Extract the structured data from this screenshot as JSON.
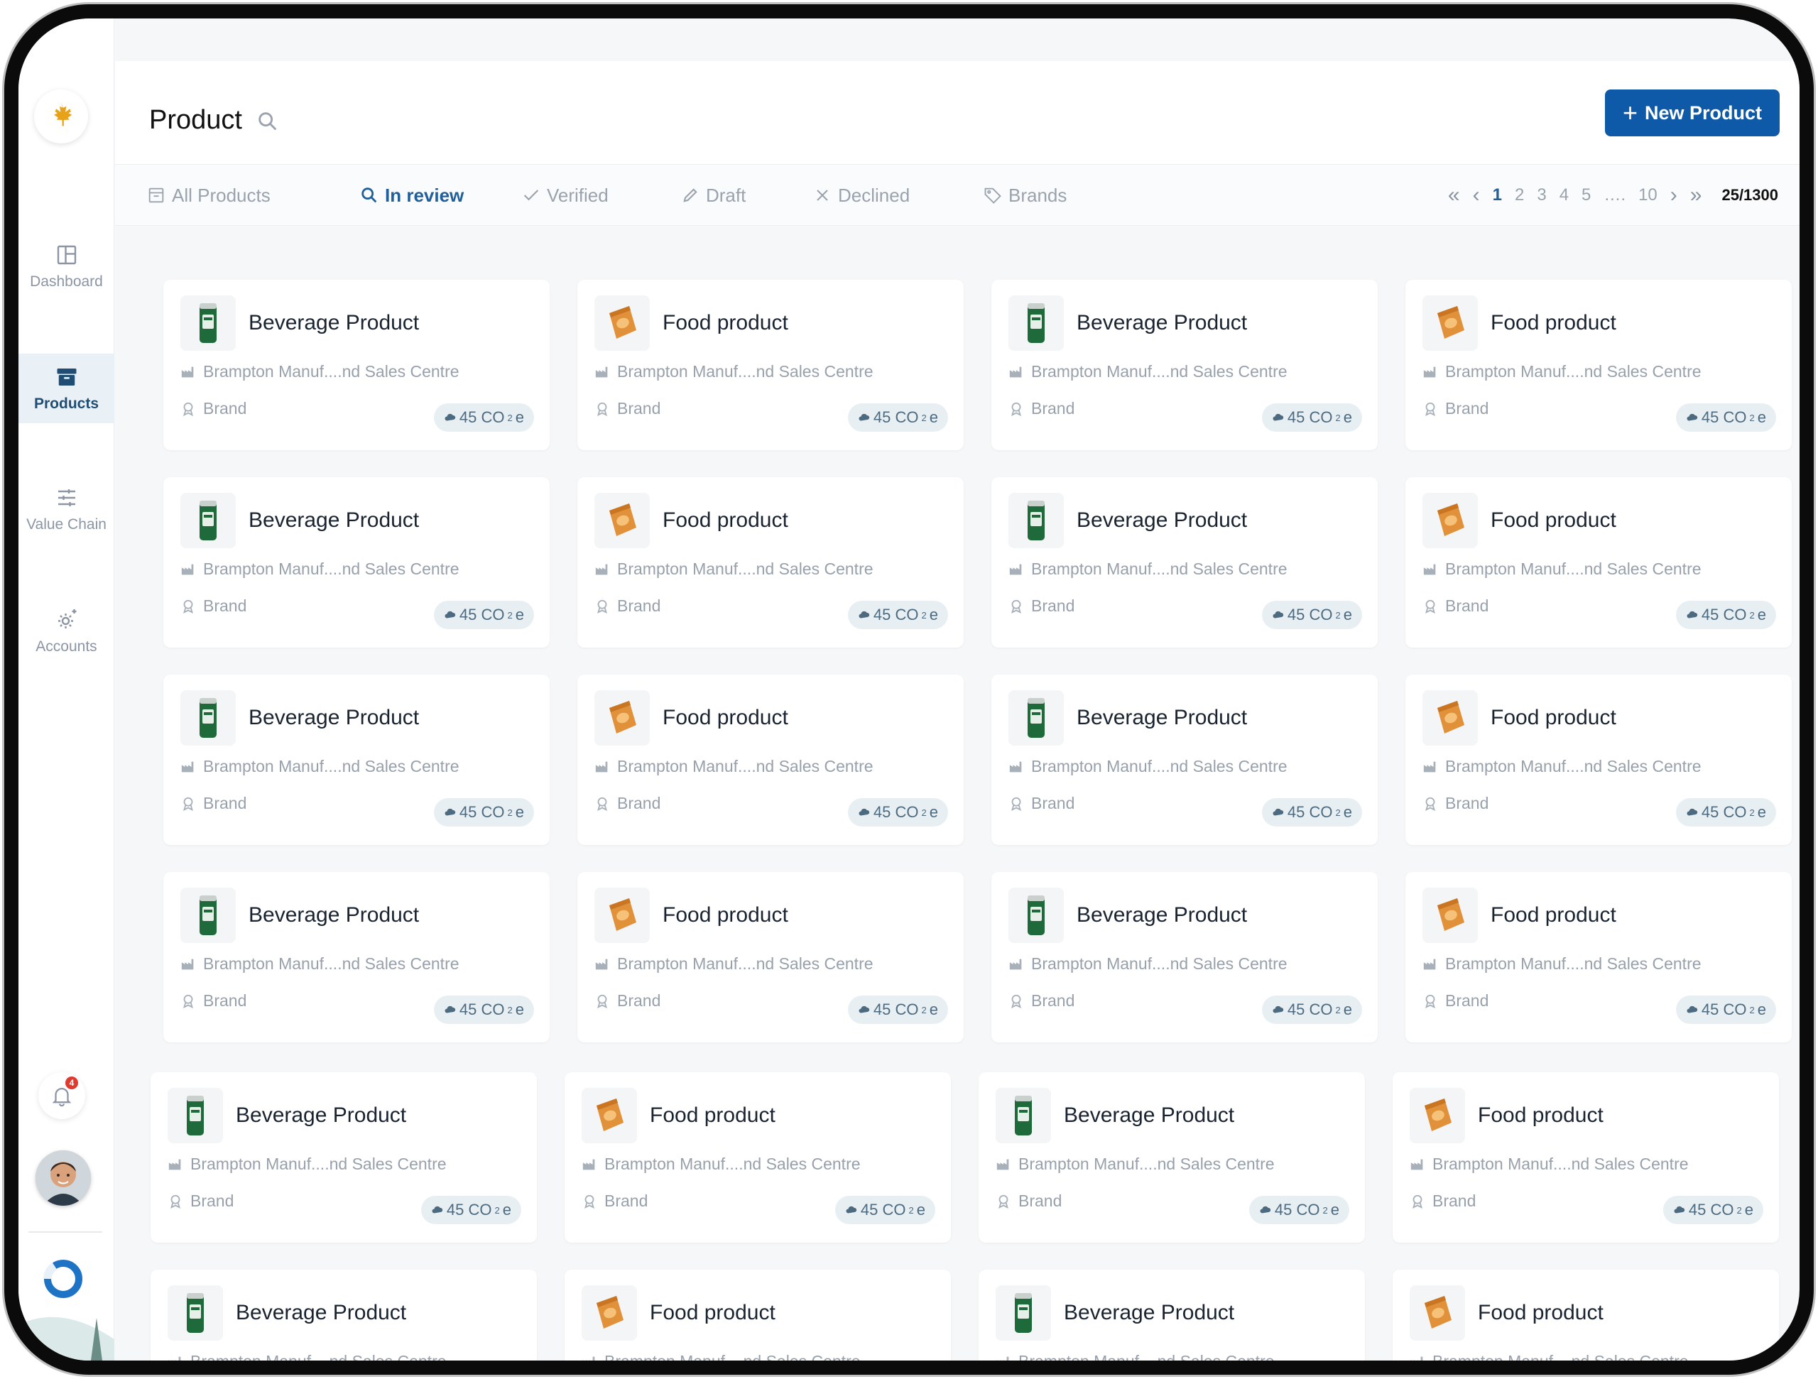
{
  "sidebar": {
    "nav": [
      {
        "label": "Dashboard",
        "icon": "dashboard-icon",
        "active": false
      },
      {
        "label": "Products",
        "icon": "products-box-icon",
        "active": true
      },
      {
        "label": "Value Chain",
        "icon": "sliders-icon",
        "active": false
      },
      {
        "label": "Accounts",
        "icon": "gear-icon",
        "active": false
      }
    ],
    "notification_count": "4"
  },
  "header": {
    "title": "Product",
    "new_button_label": "New Product"
  },
  "filters": {
    "tabs": [
      {
        "label": "All Products",
        "icon": "archive-icon",
        "active": false
      },
      {
        "label": "In review",
        "icon": "search-icon",
        "active": true
      },
      {
        "label": "Verified",
        "icon": "check-icon",
        "active": false
      },
      {
        "label": "Draft",
        "icon": "pencil-icon",
        "active": false
      },
      {
        "label": "Declined",
        "icon": "x-icon",
        "active": false
      },
      {
        "label": "Brands",
        "icon": "tag-icon",
        "active": false
      }
    ]
  },
  "pagination": {
    "pages": [
      "1",
      "2",
      "3",
      "4",
      "5",
      "….",
      "10"
    ],
    "current": "1",
    "count": "25/1300"
  },
  "products": [
    {
      "name": "Beverage Product",
      "type": "beverage",
      "location": "Brampton Manuf....nd Sales Centre",
      "brand": "Brand",
      "co2": "45 CO",
      "co2_sub": "2",
      "co2_suffix": "e"
    },
    {
      "name": "Food product",
      "type": "food",
      "location": "Brampton Manuf....nd Sales Centre",
      "brand": "Brand",
      "co2": "45 CO",
      "co2_sub": "2",
      "co2_suffix": "e"
    },
    {
      "name": "Beverage Product",
      "type": "beverage",
      "location": "Brampton Manuf....nd Sales Centre",
      "brand": "Brand",
      "co2": "45 CO",
      "co2_sub": "2",
      "co2_suffix": "e"
    },
    {
      "name": "Food product",
      "type": "food",
      "location": "Brampton Manuf....nd Sales Centre",
      "brand": "Brand",
      "co2": "45 CO",
      "co2_sub": "2",
      "co2_suffix": "e"
    },
    {
      "name": "Beverage Product",
      "type": "beverage",
      "location": "Brampton Manuf....nd Sales Centre",
      "brand": "Brand",
      "co2": "45 CO",
      "co2_sub": "2",
      "co2_suffix": "e"
    },
    {
      "name": "Food product",
      "type": "food",
      "location": "Brampton Manuf....nd Sales Centre",
      "brand": "Brand",
      "co2": "45 CO",
      "co2_sub": "2",
      "co2_suffix": "e"
    },
    {
      "name": "Beverage Product",
      "type": "beverage",
      "location": "Brampton Manuf....nd Sales Centre",
      "brand": "Brand",
      "co2": "45 CO",
      "co2_sub": "2",
      "co2_suffix": "e"
    },
    {
      "name": "Food product",
      "type": "food",
      "location": "Brampton Manuf....nd Sales Centre",
      "brand": "Brand",
      "co2": "45 CO",
      "co2_sub": "2",
      "co2_suffix": "e"
    },
    {
      "name": "Beverage Product",
      "type": "beverage",
      "location": "Brampton Manuf....nd Sales Centre",
      "brand": "Brand",
      "co2": "45 CO",
      "co2_sub": "2",
      "co2_suffix": "e"
    },
    {
      "name": "Food product",
      "type": "food",
      "location": "Brampton Manuf....nd Sales Centre",
      "brand": "Brand",
      "co2": "45 CO",
      "co2_sub": "2",
      "co2_suffix": "e"
    },
    {
      "name": "Beverage Product",
      "type": "beverage",
      "location": "Brampton Manuf....nd Sales Centre",
      "brand": "Brand",
      "co2": "45 CO",
      "co2_sub": "2",
      "co2_suffix": "e"
    },
    {
      "name": "Food product",
      "type": "food",
      "location": "Brampton Manuf....nd Sales Centre",
      "brand": "Brand",
      "co2": "45 CO",
      "co2_sub": "2",
      "co2_suffix": "e"
    },
    {
      "name": "Beverage Product",
      "type": "beverage",
      "location": "Brampton Manuf....nd Sales Centre",
      "brand": "Brand",
      "co2": "45 CO",
      "co2_sub": "2",
      "co2_suffix": "e"
    },
    {
      "name": "Food product",
      "type": "food",
      "location": "Brampton Manuf....nd Sales Centre",
      "brand": "Brand",
      "co2": "45 CO",
      "co2_sub": "2",
      "co2_suffix": "e"
    },
    {
      "name": "Beverage Product",
      "type": "beverage",
      "location": "Brampton Manuf....nd Sales Centre",
      "brand": "Brand",
      "co2": "45 CO",
      "co2_sub": "2",
      "co2_suffix": "e"
    },
    {
      "name": "Food product",
      "type": "food",
      "location": "Brampton Manuf....nd Sales Centre",
      "brand": "Brand",
      "co2": "45 CO",
      "co2_sub": "2",
      "co2_suffix": "e"
    },
    {
      "name": "Beverage Product",
      "type": "beverage",
      "location": "Brampton Manuf....nd Sales Centre",
      "brand": "Brand",
      "co2": "45 CO",
      "co2_sub": "2",
      "co2_suffix": "e"
    },
    {
      "name": "Food product",
      "type": "food",
      "location": "Brampton Manuf....nd Sales Centre",
      "brand": "Brand",
      "co2": "45 CO",
      "co2_sub": "2",
      "co2_suffix": "e"
    },
    {
      "name": "Beverage Product",
      "type": "beverage",
      "location": "Brampton Manuf....nd Sales Centre",
      "brand": "Brand",
      "co2": "45 CO",
      "co2_sub": "2",
      "co2_suffix": "e"
    },
    {
      "name": "Food product",
      "type": "food",
      "location": "Brampton Manuf....nd Sales Centre",
      "brand": "Brand",
      "co2": "45 CO",
      "co2_sub": "2",
      "co2_suffix": "e"
    },
    {
      "name": "Beverage Product",
      "type": "beverage",
      "location": "Brampton Manuf....nd Sales Centre",
      "brand": "",
      "co2": "",
      "co2_sub": "",
      "co2_suffix": ""
    },
    {
      "name": "Food product",
      "type": "food",
      "location": "Brampton Manuf....nd Sales Centre",
      "brand": "",
      "co2": "",
      "co2_sub": "",
      "co2_suffix": ""
    },
    {
      "name": "Beverage Product",
      "type": "beverage",
      "location": "Brampton Manuf....nd Sales Centre",
      "brand": "",
      "co2": "",
      "co2_sub": "",
      "co2_suffix": ""
    },
    {
      "name": "Food product",
      "type": "food",
      "location": "Brampton Manuf....nd Sales Centre",
      "brand": "",
      "co2": "",
      "co2_sub": "",
      "co2_suffix": ""
    }
  ],
  "colors": {
    "accent": "#0f5aa8",
    "active_tab": "#1f5f9a",
    "sidebar_active_bg": "#eaf1f6",
    "badge_bg": "#e8eff3",
    "beverage_can": "#1e6a3a",
    "food_bag": "#e0913a"
  }
}
